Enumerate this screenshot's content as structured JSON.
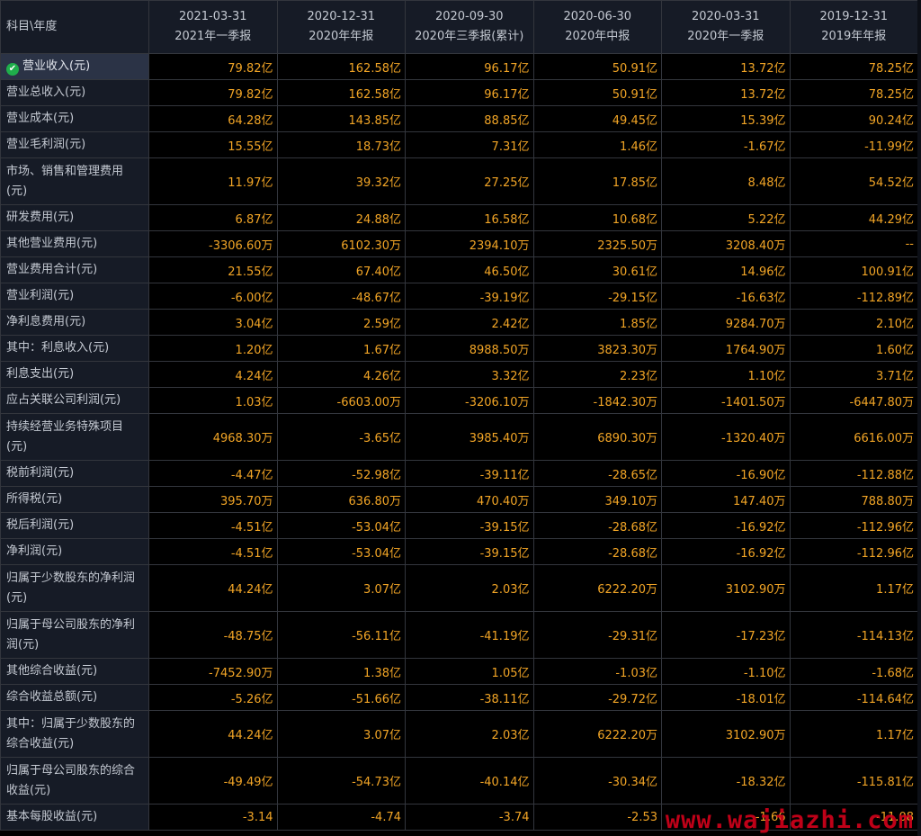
{
  "header": {
    "corner": "科目\\年度",
    "columns": [
      {
        "date": "2021-03-31",
        "sub": "2021年一季报"
      },
      {
        "date": "2020-12-31",
        "sub": "2020年年报"
      },
      {
        "date": "2020-09-30",
        "sub": "2020年三季报(累计)"
      },
      {
        "date": "2020-06-30",
        "sub": "2020年中报"
      },
      {
        "date": "2020-03-31",
        "sub": "2020年一季报"
      },
      {
        "date": "2019-12-31",
        "sub": "2019年年报"
      }
    ]
  },
  "rows": [
    {
      "label": "营业收入(元)",
      "values": [
        "79.82亿",
        "162.58亿",
        "96.17亿",
        "50.91亿",
        "13.72亿",
        "78.25亿"
      ]
    },
    {
      "label": "营业总收入(元)",
      "values": [
        "79.82亿",
        "162.58亿",
        "96.17亿",
        "50.91亿",
        "13.72亿",
        "78.25亿"
      ]
    },
    {
      "label": "营业成本(元)",
      "values": [
        "64.28亿",
        "143.85亿",
        "88.85亿",
        "49.45亿",
        "15.39亿",
        "90.24亿"
      ]
    },
    {
      "label": "营业毛利润(元)",
      "values": [
        "15.55亿",
        "18.73亿",
        "7.31亿",
        "1.46亿",
        "-1.67亿",
        "-11.99亿"
      ]
    },
    {
      "label": "市场、销售和管理费用(元)",
      "values": [
        "11.97亿",
        "39.32亿",
        "27.25亿",
        "17.85亿",
        "8.48亿",
        "54.52亿"
      ]
    },
    {
      "label": "研发费用(元)",
      "values": [
        "6.87亿",
        "24.88亿",
        "16.58亿",
        "10.68亿",
        "5.22亿",
        "44.29亿"
      ]
    },
    {
      "label": "其他营业费用(元)",
      "values": [
        "-3306.60万",
        "6102.30万",
        "2394.10万",
        "2325.50万",
        "3208.40万",
        "--"
      ]
    },
    {
      "label": "营业费用合计(元)",
      "values": [
        "21.55亿",
        "67.40亿",
        "46.50亿",
        "30.61亿",
        "14.96亿",
        "100.91亿"
      ]
    },
    {
      "label": "营业利润(元)",
      "values": [
        "-6.00亿",
        "-48.67亿",
        "-39.19亿",
        "-29.15亿",
        "-16.63亿",
        "-112.89亿"
      ]
    },
    {
      "label": "净利息费用(元)",
      "values": [
        "3.04亿",
        "2.59亿",
        "2.42亿",
        "1.85亿",
        "9284.70万",
        "2.10亿"
      ]
    },
    {
      "label": "其中：利息收入(元)",
      "values": [
        "1.20亿",
        "1.67亿",
        "8988.50万",
        "3823.30万",
        "1764.90万",
        "1.60亿"
      ]
    },
    {
      "label": "利息支出(元)",
      "values": [
        "4.24亿",
        "4.26亿",
        "3.32亿",
        "2.23亿",
        "1.10亿",
        "3.71亿"
      ]
    },
    {
      "label": "应占关联公司利润(元)",
      "values": [
        "1.03亿",
        "-6603.00万",
        "-3206.10万",
        "-1842.30万",
        "-1401.50万",
        "-6447.80万"
      ]
    },
    {
      "label": "持续经营业务特殊项目(元)",
      "values": [
        "4968.30万",
        "-3.65亿",
        "3985.40万",
        "6890.30万",
        "-1320.40万",
        "6616.00万"
      ]
    },
    {
      "label": "税前利润(元)",
      "values": [
        "-4.47亿",
        "-52.98亿",
        "-39.11亿",
        "-28.65亿",
        "-16.90亿",
        "-112.88亿"
      ]
    },
    {
      "label": "所得税(元)",
      "values": [
        "395.70万",
        "636.80万",
        "470.40万",
        "349.10万",
        "147.40万",
        "788.80万"
      ]
    },
    {
      "label": "税后利润(元)",
      "values": [
        "-4.51亿",
        "-53.04亿",
        "-39.15亿",
        "-28.68亿",
        "-16.92亿",
        "-112.96亿"
      ]
    },
    {
      "label": "净利润(元)",
      "values": [
        "-4.51亿",
        "-53.04亿",
        "-39.15亿",
        "-28.68亿",
        "-16.92亿",
        "-112.96亿"
      ]
    },
    {
      "label": "归属于少数股东的净利润(元)",
      "values": [
        "44.24亿",
        "3.07亿",
        "2.03亿",
        "6222.20万",
        "3102.90万",
        "1.17亿"
      ]
    },
    {
      "label": "归属于母公司股东的净利润(元)",
      "values": [
        "-48.75亿",
        "-56.11亿",
        "-41.19亿",
        "-29.31亿",
        "-17.23亿",
        "-114.13亿"
      ]
    },
    {
      "label": "其他综合收益(元)",
      "values": [
        "-7452.90万",
        "1.38亿",
        "1.05亿",
        "-1.03亿",
        "-1.10亿",
        "-1.68亿"
      ]
    },
    {
      "label": "综合收益总额(元)",
      "values": [
        "-5.26亿",
        "-51.66亿",
        "-38.11亿",
        "-29.72亿",
        "-18.01亿",
        "-114.64亿"
      ]
    },
    {
      "label": "其中：归属于少数股东的综合收益(元)",
      "values": [
        "44.24亿",
        "3.07亿",
        "2.03亿",
        "6222.20万",
        "3102.90万",
        "1.17亿"
      ]
    },
    {
      "label": "归属于母公司股东的综合收益(元)",
      "values": [
        "-49.49亿",
        "-54.73亿",
        "-40.14亿",
        "-30.34亿",
        "-18.32亿",
        "-115.81亿"
      ]
    },
    {
      "label": "基本每股收益(元)",
      "values": [
        "-3.14",
        "-4.74",
        "-3.74",
        "-2.53",
        "-1.66",
        "-11.08"
      ]
    }
  ],
  "watermark": "www.wajiazhi.com",
  "colors": {
    "label_bg": "#161b26",
    "value_text": "#f2a526",
    "selected_bg": "#2b3346",
    "check": "#1fae4b",
    "watermark": "#d0021b"
  }
}
